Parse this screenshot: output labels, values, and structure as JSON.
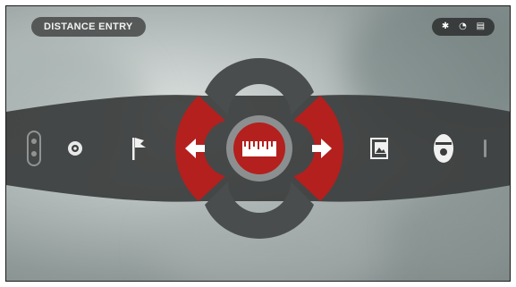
{
  "header": {
    "title": "DISTANCE ENTRY"
  },
  "status_bar": {
    "icons": [
      "bluetooth-icon",
      "wifi-icon",
      "battery-icon"
    ]
  },
  "menu": {
    "left_items": [
      "ballistics-icon",
      "target-icon",
      "flag-icon"
    ],
    "center_item": "ruler-icon",
    "right_items": [
      "gallery-icon",
      "cartridge-icon",
      "info-icon"
    ],
    "arrows": [
      "arrow-left-icon",
      "arrow-right-icon"
    ]
  },
  "colors": {
    "accent_red": "#b3201e",
    "dark_gray": "#4a4d4d",
    "band": "#3a3c3c",
    "ring": "#8c8f8f"
  }
}
